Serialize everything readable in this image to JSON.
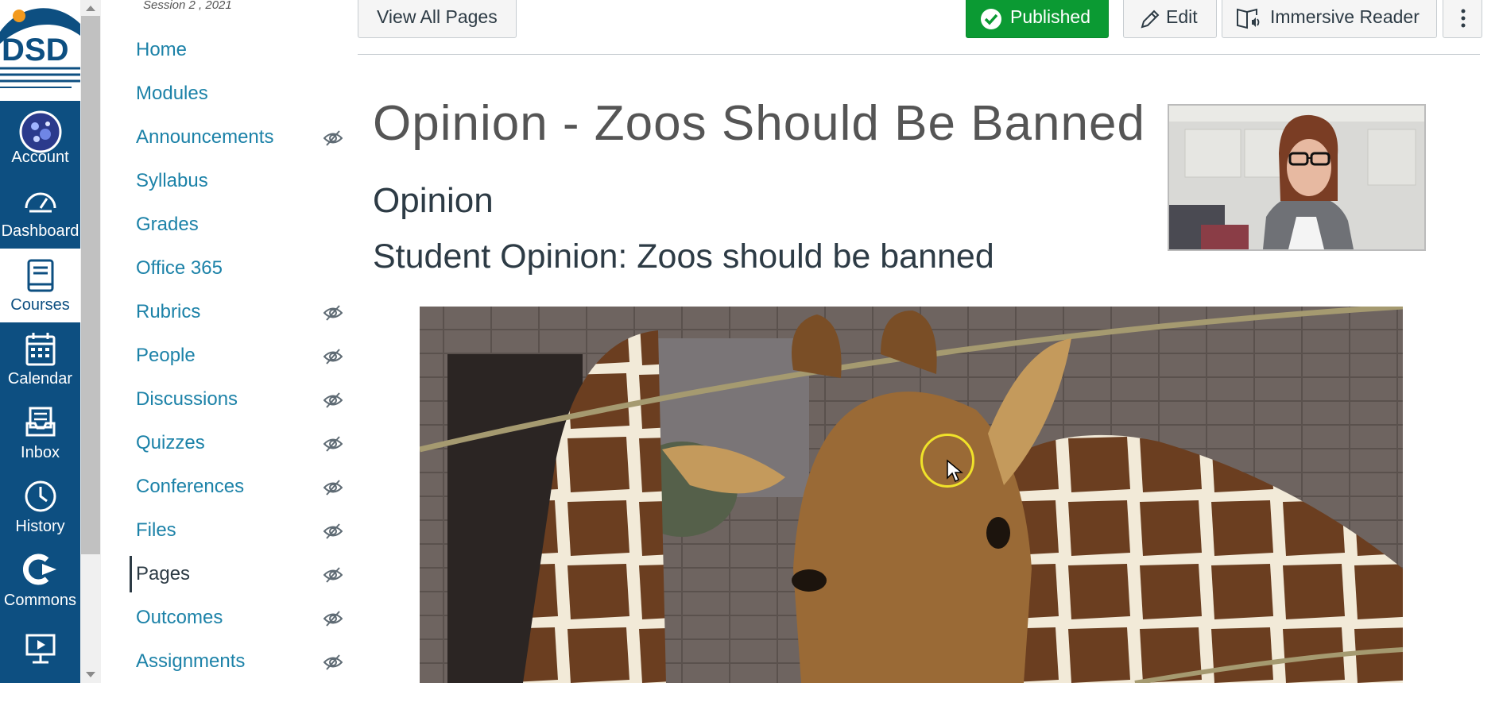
{
  "global_nav": {
    "logo_text": "DSD",
    "items": [
      {
        "label": "Account",
        "icon": "account-avatar"
      },
      {
        "label": "Dashboard",
        "icon": "dashboard-icon"
      },
      {
        "label": "Courses",
        "icon": "courses-icon"
      },
      {
        "label": "Calendar",
        "icon": "calendar-icon"
      },
      {
        "label": "Inbox",
        "icon": "inbox-icon"
      },
      {
        "label": "History",
        "icon": "history-icon"
      },
      {
        "label": "Commons",
        "icon": "commons-icon"
      },
      {
        "label": "Studio",
        "icon": "studio-icon"
      }
    ]
  },
  "course_nav": {
    "session": "Session 2 , 2021",
    "items": [
      {
        "label": "Home",
        "hidden": false
      },
      {
        "label": "Modules",
        "hidden": false
      },
      {
        "label": "Announcements",
        "hidden": true
      },
      {
        "label": "Syllabus",
        "hidden": false
      },
      {
        "label": "Grades",
        "hidden": false
      },
      {
        "label": "Office 365",
        "hidden": false
      },
      {
        "label": "Rubrics",
        "hidden": true
      },
      {
        "label": "People",
        "hidden": true
      },
      {
        "label": "Discussions",
        "hidden": true
      },
      {
        "label": "Quizzes",
        "hidden": true
      },
      {
        "label": "Conferences",
        "hidden": true
      },
      {
        "label": "Files",
        "hidden": true
      },
      {
        "label": "Pages",
        "hidden": true,
        "active": true
      },
      {
        "label": "Outcomes",
        "hidden": true
      },
      {
        "label": "Assignments",
        "hidden": true
      }
    ]
  },
  "toolbar": {
    "view_all_pages": "View All Pages",
    "published": "Published",
    "edit": "Edit",
    "immersive_reader": "Immersive Reader"
  },
  "content": {
    "title": "Opinion - Zoos Should Be Banned",
    "heading": "Opinion",
    "subheading": "Student Opinion: Zoos should be banned"
  },
  "colors": {
    "nav_bg": "#0d4f81",
    "link": "#1c82a8",
    "published_green": "#0b9a33",
    "text_dark": "#2d3b45"
  }
}
